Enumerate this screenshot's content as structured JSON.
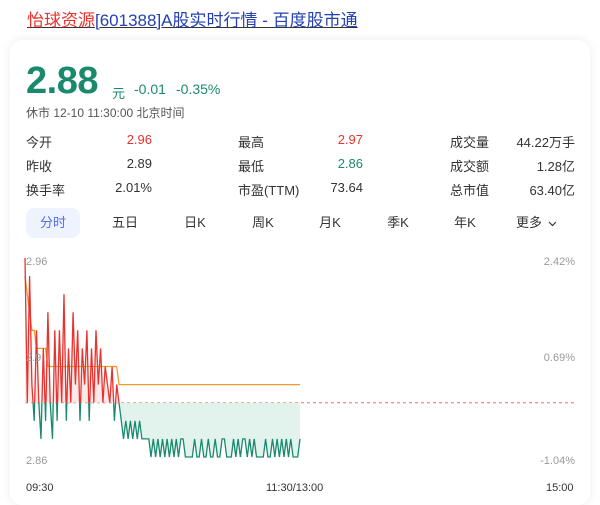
{
  "title": {
    "name": "怡球资源",
    "rest": "[601388]A股实时行情 - 百度股市通"
  },
  "quote": {
    "price": "2.88",
    "unit": "元",
    "change": "-0.01",
    "change_pct": "-0.35%",
    "status": "休市 12-10 11:30:00 北京时间"
  },
  "stats": [
    {
      "label": "今开",
      "value": "2.96",
      "color": "#e8322d"
    },
    {
      "label": "最高",
      "value": "2.97",
      "color": "#e8322d"
    },
    {
      "label": "成交量",
      "value": "44.22万手",
      "color": "#333333"
    },
    {
      "label": "昨收",
      "value": "2.89",
      "color": "#333333"
    },
    {
      "label": "最低",
      "value": "2.86",
      "color": "#1a8a6e"
    },
    {
      "label": "成交额",
      "value": "1.28亿",
      "color": "#333333"
    },
    {
      "label": "换手率",
      "value": "2.01%",
      "color": "#333333"
    },
    {
      "label": "市盈(TTM)",
      "value": "73.64",
      "color": "#333333"
    },
    {
      "label": "总市值",
      "value": "63.40亿",
      "color": "#333333"
    }
  ],
  "tabs": [
    "分时",
    "五日",
    "日K",
    "周K",
    "月K",
    "季K",
    "年K",
    "更多"
  ],
  "active_tab": "分时",
  "colors": {
    "up": "#e8322d",
    "down": "#1a8a6e",
    "avg_line": "#f39a2b",
    "accent": "#4e6ef2"
  },
  "chart_data": {
    "type": "line",
    "y_left_ticks": [
      "2.96",
      "2.9",
      "2.86"
    ],
    "y_right_ticks": [
      "2.42%",
      "0.69%",
      "-1.04%"
    ],
    "x_ticks": [
      "09:30",
      "11:30/13:00",
      "15:00"
    ],
    "ylim": [
      2.855,
      2.97
    ],
    "prev_close": 2.89,
    "series": [
      {
        "name": "price",
        "values": [
          2.97,
          2.89,
          2.96,
          2.9,
          2.88,
          2.93,
          2.89,
          2.87,
          2.92,
          2.88,
          2.94,
          2.89,
          2.87,
          2.93,
          2.88,
          2.93,
          2.89,
          2.95,
          2.88,
          2.92,
          2.89,
          2.94,
          2.9,
          2.93,
          2.88,
          2.92,
          2.9,
          2.93,
          2.88,
          2.92,
          2.89,
          2.93,
          2.9,
          2.92,
          2.89,
          2.91,
          2.9,
          2.89,
          2.91,
          2.88,
          2.9,
          2.89,
          2.88,
          2.87,
          2.88,
          2.87,
          2.88,
          2.87,
          2.88,
          2.87,
          2.88,
          2.87,
          2.87,
          2.87,
          2.87,
          2.86,
          2.87,
          2.86,
          2.87,
          2.86,
          2.87,
          2.86,
          2.87,
          2.86,
          2.87,
          2.86,
          2.87,
          2.86,
          2.87,
          2.87,
          2.86,
          2.86,
          2.86,
          2.86,
          2.87,
          2.86,
          2.86,
          2.87,
          2.86,
          2.86,
          2.87,
          2.86,
          2.86,
          2.87,
          2.86,
          2.86,
          2.87,
          2.87,
          2.86,
          2.86,
          2.86,
          2.87,
          2.86,
          2.87,
          2.86,
          2.87,
          2.87,
          2.86,
          2.87,
          2.86,
          2.87,
          2.86,
          2.86,
          2.86,
          2.86,
          2.87,
          2.86,
          2.86,
          2.87,
          2.86,
          2.87,
          2.86,
          2.87,
          2.86,
          2.87,
          2.86,
          2.87,
          2.86,
          2.86,
          2.86,
          2.87
        ]
      },
      {
        "name": "avg",
        "values": [
          2.96,
          2.95,
          2.94,
          2.93,
          2.93,
          2.92,
          2.92,
          2.92,
          2.92,
          2.92,
          2.91,
          2.91,
          2.91,
          2.91,
          2.91,
          2.91,
          2.91,
          2.91,
          2.91,
          2.91,
          2.91,
          2.91,
          2.91,
          2.91,
          2.91,
          2.91,
          2.91,
          2.91,
          2.91,
          2.91,
          2.91,
          2.91,
          2.91,
          2.91,
          2.91,
          2.91,
          2.91,
          2.91,
          2.91,
          2.91,
          2.91,
          2.9,
          2.9,
          2.9,
          2.9,
          2.9,
          2.9,
          2.9,
          2.9,
          2.9,
          2.9,
          2.9,
          2.9,
          2.9,
          2.9,
          2.9,
          2.9,
          2.9,
          2.9,
          2.9,
          2.9,
          2.9,
          2.9,
          2.9,
          2.9,
          2.9,
          2.9,
          2.9,
          2.9,
          2.9,
          2.9,
          2.9,
          2.9,
          2.9,
          2.9,
          2.9,
          2.9,
          2.9,
          2.9,
          2.9,
          2.9,
          2.9,
          2.9,
          2.9,
          2.9,
          2.9,
          2.9,
          2.9,
          2.9,
          2.9,
          2.9,
          2.9,
          2.9,
          2.9,
          2.9,
          2.9,
          2.9,
          2.9,
          2.9,
          2.9,
          2.9,
          2.9,
          2.9,
          2.9,
          2.9,
          2.9,
          2.9,
          2.9,
          2.9,
          2.9,
          2.9,
          2.9,
          2.9,
          2.9,
          2.9,
          2.9,
          2.9,
          2.9,
          2.9,
          2.9,
          2.9
        ]
      }
    ]
  }
}
